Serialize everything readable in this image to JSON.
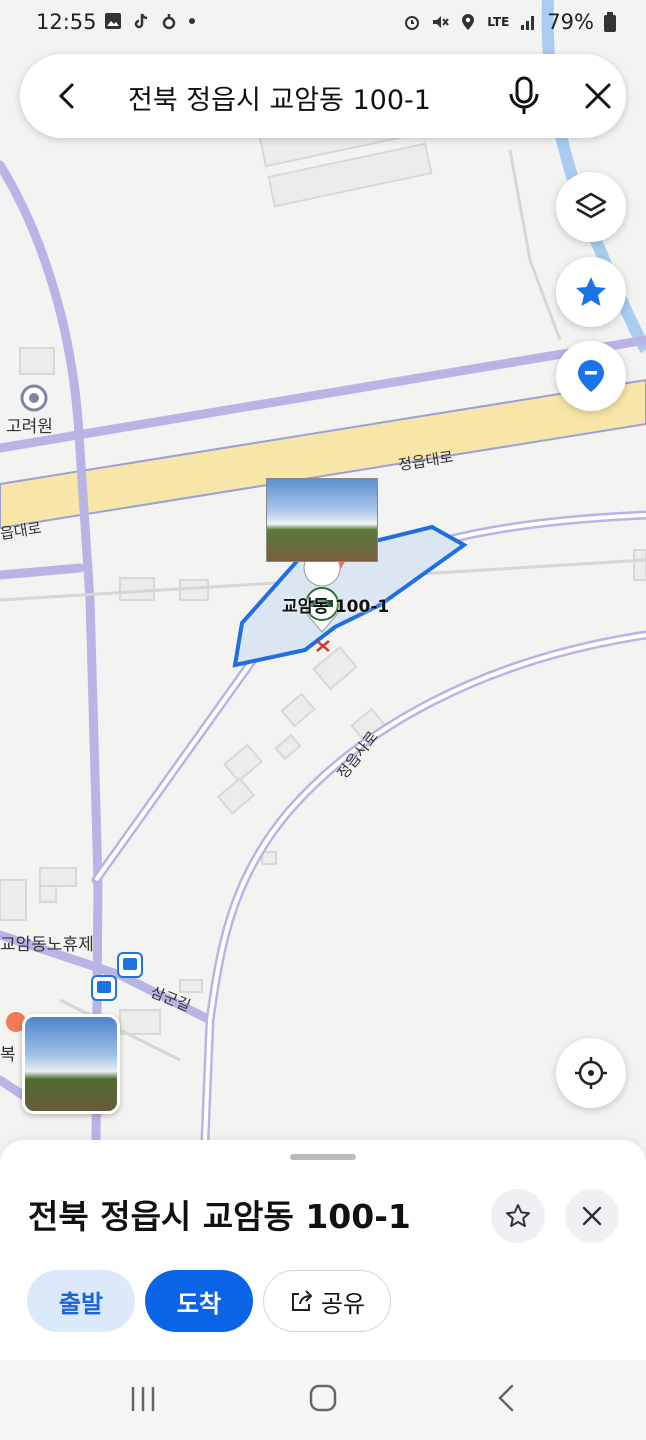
{
  "status_bar": {
    "time": "12:55",
    "battery": "79%",
    "network": "LTE"
  },
  "search": {
    "query": "전북 정읍시 교암동 100-1"
  },
  "map": {
    "labels": {
      "goryeowon": "고려원",
      "road_jeongeupdaero_1": "정읍대로",
      "road_jeongeupdaero_2": "읍대로",
      "road_jeongeupsaro": "정읍사로",
      "road_samgungil": "삼군길",
      "place_gyoamdong_hall": "교암동노휴제",
      "place_partial": "복"
    },
    "parcel_label": "교암동 100-1",
    "accent_color": "#1a73e8",
    "highlight_fill": "#dce6f3"
  },
  "place_sheet": {
    "title": "전북 정읍시 교암동 100-1",
    "departure_label": "출발",
    "arrival_label": "도착",
    "share_label": "공유"
  }
}
